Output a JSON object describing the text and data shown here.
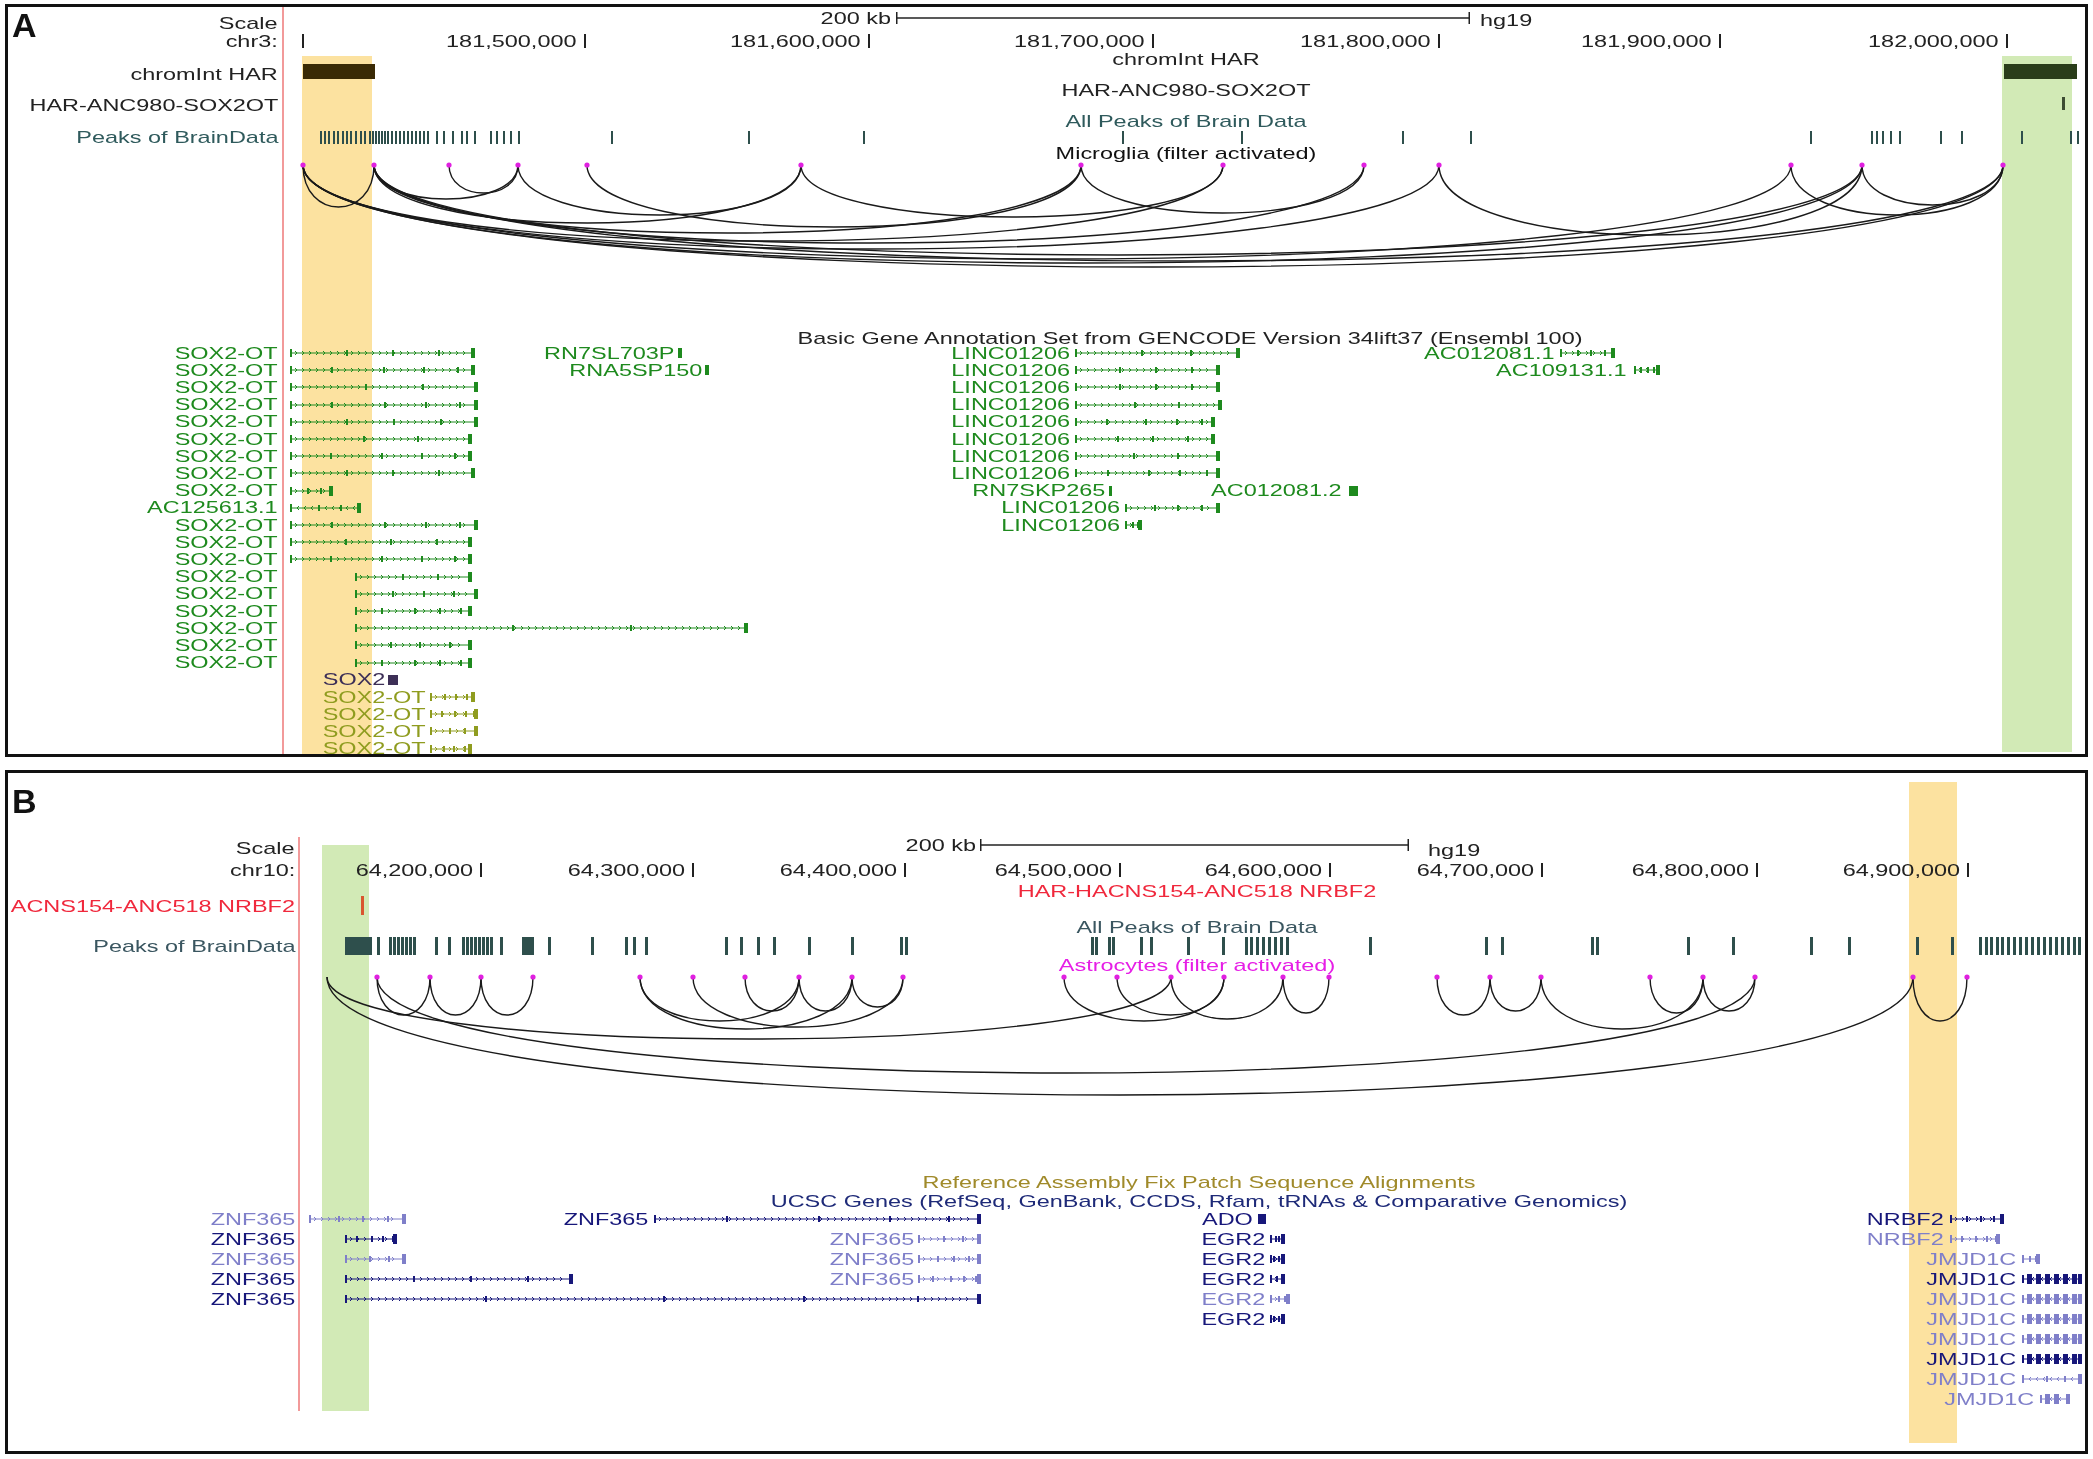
{
  "panels": [
    {
      "label": "A",
      "ruler": {
        "scale_label": "Scale",
        "chrom_label": "chr3:",
        "scale_bar_label": "200 kb",
        "assembly": "hg19",
        "ticks": [
          "181,500,000",
          "181,600,000",
          "181,700,000",
          "181,800,000",
          "181,900,000",
          "182,000,000"
        ]
      },
      "highlights": [
        {
          "color": "#fce2a0"
        },
        {
          "color": "#d2eab6"
        }
      ],
      "tracks": [
        {
          "kind": "bed",
          "label": "chromInt HAR",
          "title": "chromInt HAR",
          "color": "#222222"
        },
        {
          "kind": "bed",
          "label": "HAR-ANC980-SOX2OT",
          "title": "HAR-ANC980-SOX2OT",
          "color": "#222222"
        },
        {
          "kind": "peaks",
          "label": "Peaks of BrainData",
          "title": "All Peaks of Brain Data",
          "color": "#2f5a5c"
        },
        {
          "kind": "arcs",
          "title": "Microglia (filter activated)",
          "color": "#111111"
        }
      ],
      "gene_track": {
        "titles": [
          {
            "text": "Basic Gene Annotation Set from GENCODE Version 34lift37 (Ensembl 100)",
            "color": "#222222"
          }
        ],
        "genes": [
          {
            "name": "SOX2-OT",
            "color": "#1e8a1e"
          },
          {
            "name": "RN7SL703P",
            "color": "#1e8a1e"
          },
          {
            "name": "LINC01206",
            "color": "#1e8a1e"
          },
          {
            "name": "AC012081.1",
            "color": "#1e8a1e"
          },
          {
            "name": "SOX2-OT",
            "color": "#1e8a1e"
          },
          {
            "name": "RNA5SP150",
            "color": "#1e8a1e"
          },
          {
            "name": "LINC01206",
            "color": "#1e8a1e"
          },
          {
            "name": "AC109131.1",
            "color": "#1e8a1e"
          },
          {
            "name": "SOX2-OT",
            "color": "#1e8a1e"
          },
          {
            "name": "LINC01206",
            "color": "#1e8a1e"
          },
          {
            "name": "SOX2-OT",
            "color": "#1e8a1e"
          },
          {
            "name": "LINC01206",
            "color": "#1e8a1e"
          },
          {
            "name": "SOX2-OT",
            "color": "#1e8a1e"
          },
          {
            "name": "LINC01206",
            "color": "#1e8a1e"
          },
          {
            "name": "SOX2-OT",
            "color": "#1e8a1e"
          },
          {
            "name": "LINC01206",
            "color": "#1e8a1e"
          },
          {
            "name": "SOX2-OT",
            "color": "#1e8a1e"
          },
          {
            "name": "LINC01206",
            "color": "#1e8a1e"
          },
          {
            "name": "SOX2-OT",
            "color": "#1e8a1e"
          },
          {
            "name": "LINC01206",
            "color": "#1e8a1e"
          },
          {
            "name": "SOX2-OT",
            "color": "#1e8a1e"
          },
          {
            "name": "RN7SKP265",
            "color": "#1e8a1e"
          },
          {
            "name": "AC012081.2",
            "color": "#1e8a1e"
          },
          {
            "name": "AC125613.1",
            "color": "#1e8a1e"
          },
          {
            "name": "LINC01206",
            "color": "#1e8a1e"
          },
          {
            "name": "SOX2-OT",
            "color": "#1e8a1e"
          },
          {
            "name": "LINC01206",
            "color": "#1e8a1e"
          },
          {
            "name": "SOX2-OT",
            "color": "#1e8a1e"
          },
          {
            "name": "SOX2-OT",
            "color": "#1e8a1e"
          },
          {
            "name": "SOX2-OT",
            "color": "#1e8a1e"
          },
          {
            "name": "SOX2-OT",
            "color": "#1e8a1e"
          },
          {
            "name": "SOX2-OT",
            "color": "#1e8a1e"
          },
          {
            "name": "SOX2-OT",
            "color": "#1e8a1e"
          },
          {
            "name": "SOX2-OT",
            "color": "#1e8a1e"
          },
          {
            "name": "SOX2-OT",
            "color": "#1e8a1e"
          },
          {
            "name": "SOX2",
            "color": "#3d2f57"
          },
          {
            "name": "SOX2-OT",
            "color": "#8f9c1f"
          },
          {
            "name": "SOX2-OT",
            "color": "#8f9c1f"
          },
          {
            "name": "SOX2-OT",
            "color": "#8f9c1f"
          },
          {
            "name": "SOX2-OT",
            "color": "#8f9c1f"
          }
        ]
      }
    },
    {
      "label": "B",
      "ruler": {
        "scale_label": "Scale",
        "chrom_label": "chr10:",
        "scale_bar_label": "200 kb",
        "assembly": "hg19",
        "ticks": [
          "64,200,000",
          "64,300,000",
          "64,400,000",
          "64,500,000",
          "64,600,000",
          "64,700,000",
          "64,800,000",
          "64,900,000"
        ]
      },
      "highlights": [
        {
          "color": "#d2eab6"
        },
        {
          "color": "#fce2a0"
        }
      ],
      "tracks": [
        {
          "kind": "bed",
          "label": "ACNS154-ANC518 NRBF2",
          "title": "HAR-HACNS154-ANC518 NRBF2",
          "color": "#f0283c"
        },
        {
          "kind": "peaks",
          "label": "Peaks of BrainData",
          "title": "All Peaks of Brain Data",
          "color": "#3a5660"
        },
        {
          "kind": "arcs",
          "title": "Astrocytes (filter activated)",
          "color": "#e61ee6"
        }
      ],
      "gene_track": {
        "titles": [
          {
            "text": "Reference Assembly Fix Patch Sequence Alignments",
            "color": "#a08a2a"
          },
          {
            "text": "UCSC Genes (RefSeq, GenBank, CCDS, Rfam, tRNAs & Comparative Genomics)",
            "color": "#1e2a78"
          }
        ],
        "genes": [
          {
            "name": "ZNF365",
            "color": "#7f7fc9"
          },
          {
            "name": "ZNF365",
            "color": "#17177a"
          },
          {
            "name": "ADO",
            "color": "#17177a"
          },
          {
            "name": "NRBF2",
            "color": "#17177a"
          },
          {
            "name": "ZNF365",
            "color": "#17177a"
          },
          {
            "name": "ZNF365",
            "color": "#7f7fc9"
          },
          {
            "name": "EGR2",
            "color": "#17177a"
          },
          {
            "name": "NRBF2",
            "color": "#7f7fc9"
          },
          {
            "name": "ZNF365",
            "color": "#7f7fc9"
          },
          {
            "name": "ZNF365",
            "color": "#7f7fc9"
          },
          {
            "name": "EGR2",
            "color": "#17177a"
          },
          {
            "name": "JMJD1C",
            "color": "#7f7fc9"
          },
          {
            "name": "ZNF365",
            "color": "#17177a"
          },
          {
            "name": "ZNF365",
            "color": "#7f7fc9"
          },
          {
            "name": "EGR2",
            "color": "#17177a"
          },
          {
            "name": "JMJD1C",
            "color": "#17177a"
          },
          {
            "name": "ZNF365",
            "color": "#17177a"
          },
          {
            "name": "EGR2",
            "color": "#7f7fc9"
          },
          {
            "name": "JMJD1C",
            "color": "#7f7fc9"
          },
          {
            "name": "EGR2",
            "color": "#17177a"
          },
          {
            "name": "JMJD1C",
            "color": "#7f7fc9"
          },
          {
            "name": "JMJD1C",
            "color": "#7f7fc9"
          },
          {
            "name": "JMJD1C",
            "color": "#17177a"
          },
          {
            "name": "JMJD1C",
            "color": "#7f7fc9"
          },
          {
            "name": "JMJD1C",
            "color": "#7f7fc9"
          }
        ]
      }
    }
  ]
}
